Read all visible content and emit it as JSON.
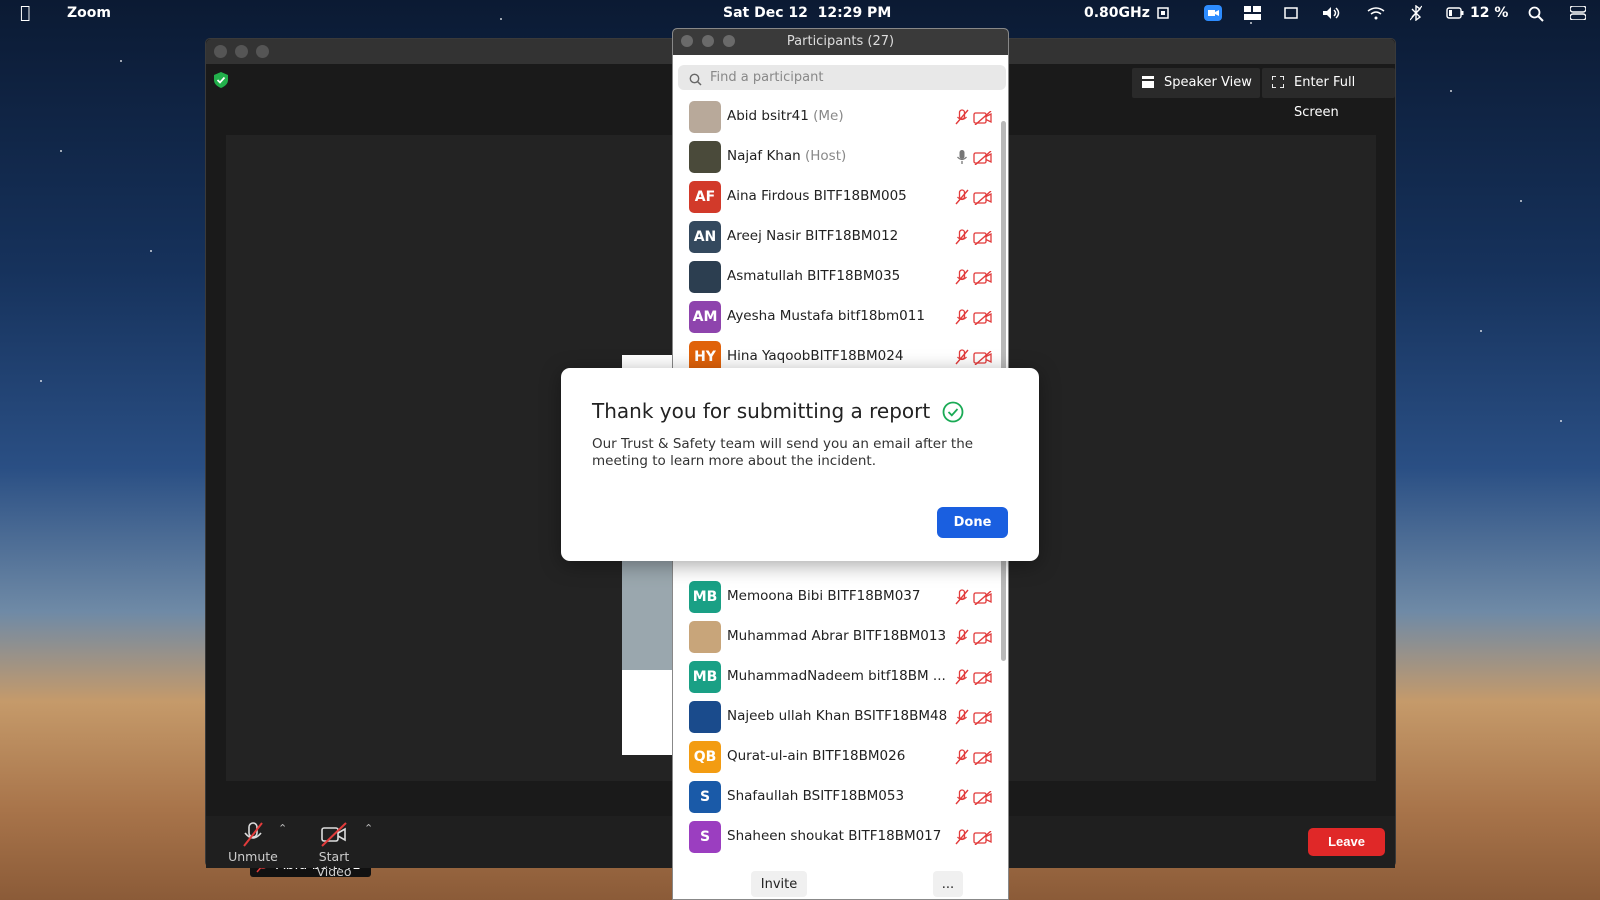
{
  "menubar": {
    "app_name": "Zoom",
    "datetime": "Sat Dec 12  12:29 PM",
    "cpu": "0.80GHz",
    "battery": "12 %",
    "icons": [
      "apple-icon",
      "cpu-icon",
      "zoom-status-icon",
      "layout-icon",
      "display-icon",
      "volume-icon",
      "wifi-icon",
      "bluetooth-icon",
      "battery-icon",
      "search-icon",
      "control-center-icon"
    ]
  },
  "meeting": {
    "speaker_view": "Speaker View",
    "full_screen": "Enter Full Screen",
    "self_name": "Abid bsitr41",
    "unmute": "Unmute",
    "start_video": "Start Video",
    "leave": "Leave",
    "colors": {
      "leave": "#e02828",
      "shield": "#22b04b"
    }
  },
  "participants": {
    "title": "Participants (27)",
    "search_placeholder": "Find a participant",
    "invite": "Invite",
    "more": "...",
    "list_top": [
      {
        "name": "Abid bsitr41",
        "role": "(Me)",
        "initials": "",
        "color": "#b8a99a",
        "mic": "muted"
      },
      {
        "name": "Najaf Khan",
        "role": "(Host)",
        "initials": "",
        "color": "#4a4a3a",
        "mic": "on"
      },
      {
        "name": "Aina Firdous BITF18BM005",
        "role": "",
        "initials": "AF",
        "color": "#d23a2a",
        "mic": "muted"
      },
      {
        "name": "Areej Nasir BITF18BM012",
        "role": "",
        "initials": "AN",
        "color": "#34495e",
        "mic": "muted"
      },
      {
        "name": "Asmatullah BITF18BM035",
        "role": "",
        "initials": "",
        "color": "#2c3e50",
        "mic": "muted"
      },
      {
        "name": "Ayesha Mustafa bitf18bm011",
        "role": "",
        "initials": "AM",
        "color": "#8e44ad",
        "mic": "muted"
      },
      {
        "name": "Hina YaqoobBITF18BM024",
        "role": "",
        "initials": "HY",
        "color": "#e0620a",
        "mic": "muted"
      }
    ],
    "list_bottom": [
      {
        "name": "Memoona Bibi BITF18BM037",
        "role": "",
        "initials": "MB",
        "color": "#1aa085",
        "mic": "muted"
      },
      {
        "name": "Muhammad Abrar BITF18BM013",
        "role": "",
        "initials": "",
        "color": "#c8a57a",
        "mic": "muted"
      },
      {
        "name": "MuhammadNadeem bitf18BM ...",
        "role": "",
        "initials": "MB",
        "color": "#1aa085",
        "mic": "muted"
      },
      {
        "name": "Najeeb ullah Khan BSITF18BM48",
        "role": "",
        "initials": "",
        "color": "#1a4b8c",
        "mic": "muted"
      },
      {
        "name": "Qurat-ul-ain BITF18BM026",
        "role": "",
        "initials": "QB",
        "color": "#f39c12",
        "mic": "muted"
      },
      {
        "name": "Shafaullah BSITF18BM053",
        "role": "",
        "initials": "S",
        "color": "#1a5aa8",
        "mic": "muted"
      },
      {
        "name": "Shaheen shoukat BITF18BM017",
        "role": "",
        "initials": "S",
        "color": "#9b3ec0",
        "mic": "muted"
      }
    ]
  },
  "dialog": {
    "title": "Thank you for submitting a report",
    "body": "Our Trust & Safety team will send you an email after the meeting to learn more about the incident.",
    "done": "Done",
    "colors": {
      "check": "#1aaa55",
      "done": "#1a5fe0"
    }
  }
}
